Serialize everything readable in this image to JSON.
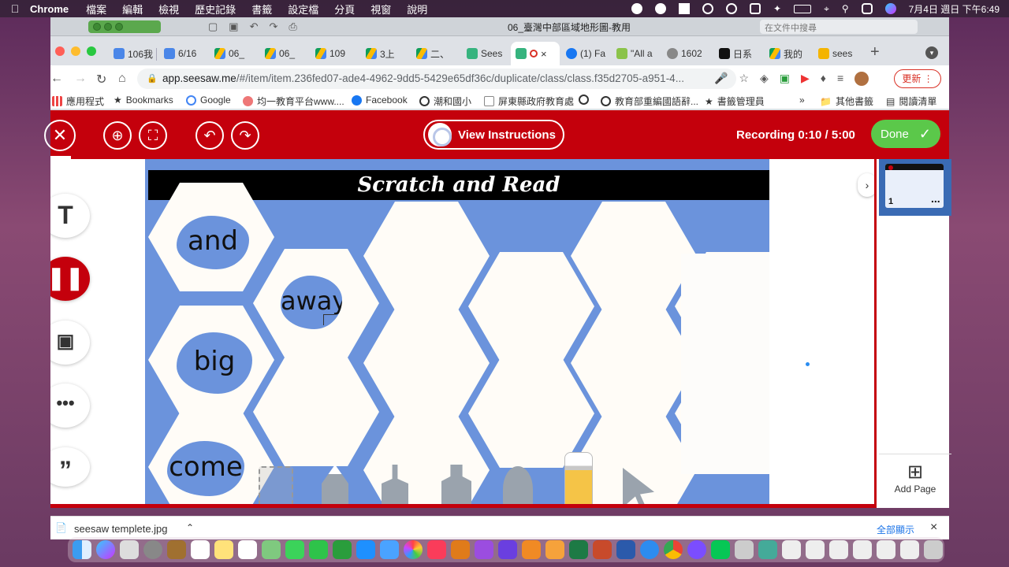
{
  "menubar": {
    "app": "Chrome",
    "items": [
      "檔案",
      "編輯",
      "檢視",
      "歷史記錄",
      "書籤",
      "設定檔",
      "分頁",
      "視窗",
      "說明"
    ],
    "datetime": "7月4日 週日 下午6:49"
  },
  "doc_window": {
    "title": "06_臺灣中部區域地形圖-教用",
    "search_placeholder": "在文件中搜尋"
  },
  "tabs": [
    {
      "label": "106我"
    },
    {
      "label": "6/16"
    },
    {
      "label": "06_"
    },
    {
      "label": "06_"
    },
    {
      "label": "109"
    },
    {
      "label": "3上"
    },
    {
      "label": "二、"
    },
    {
      "label": "Sees"
    },
    {
      "label": ""
    },
    {
      "label": "(1) Fa"
    },
    {
      "label": "\"All a"
    },
    {
      "label": "1602"
    },
    {
      "label": "日系"
    },
    {
      "label": "我的"
    },
    {
      "label": "sees"
    }
  ],
  "address": {
    "domain": "app.seesaw.me",
    "path": "/#/item/item.236fed07-ade4-4962-9dd5-5429e65df36c/duplicate/class/class.f35d2705-a951-4...",
    "update_label": "更新"
  },
  "bookmarks": [
    {
      "label": "應用程式"
    },
    {
      "label": "Bookmarks"
    },
    {
      "label": "Google"
    },
    {
      "label": "均一教育平台www...."
    },
    {
      "label": "Facebook"
    },
    {
      "label": "潮和國小"
    },
    {
      "label": "屏東縣政府教育處"
    },
    {
      "label": ""
    },
    {
      "label": "教育部重編國語辭..."
    },
    {
      "label": "書籤管理員"
    }
  ],
  "bookmarks_right": {
    "more": "»",
    "other": "其他書籤",
    "reading": "閱讀清單"
  },
  "toolbar": {
    "instructions_label": "View Instructions",
    "recording": "Recording 0:10 / 5:00",
    "done_label": "Done"
  },
  "worksheet": {
    "title": "Scratch and Read",
    "words": [
      "and",
      "away",
      "big",
      "come"
    ]
  },
  "side_tools": [
    "text-tool",
    "pause-recording",
    "camera-tool",
    "more-tools",
    "quote-tool"
  ],
  "pages": {
    "page_number": "1",
    "more": "...",
    "add_page_label": "Add Page"
  },
  "download": {
    "filename": "seesaw templete.jpg",
    "show_all": "全部顯示"
  }
}
